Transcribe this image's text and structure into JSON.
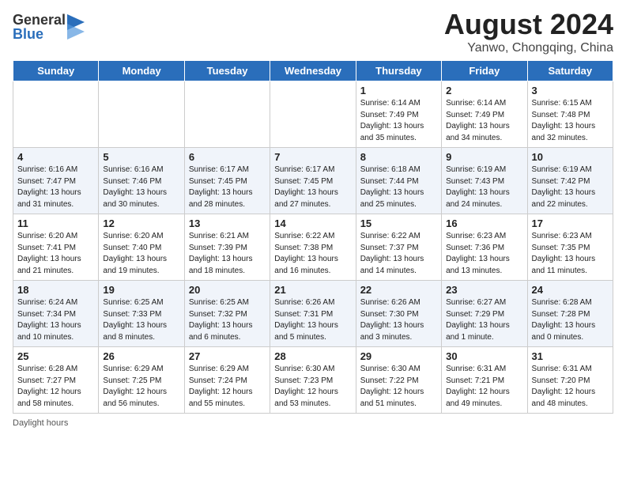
{
  "header": {
    "logo_general": "General",
    "logo_blue": "Blue",
    "title": "August 2024",
    "subtitle": "Yanwo, Chongqing, China"
  },
  "days_of_week": [
    "Sunday",
    "Monday",
    "Tuesday",
    "Wednesday",
    "Thursday",
    "Friday",
    "Saturday"
  ],
  "weeks": [
    [
      {
        "day": "",
        "info": ""
      },
      {
        "day": "",
        "info": ""
      },
      {
        "day": "",
        "info": ""
      },
      {
        "day": "",
        "info": ""
      },
      {
        "day": "1",
        "info": "Sunrise: 6:14 AM\nSunset: 7:49 PM\nDaylight: 13 hours\nand 35 minutes."
      },
      {
        "day": "2",
        "info": "Sunrise: 6:14 AM\nSunset: 7:49 PM\nDaylight: 13 hours\nand 34 minutes."
      },
      {
        "day": "3",
        "info": "Sunrise: 6:15 AM\nSunset: 7:48 PM\nDaylight: 13 hours\nand 32 minutes."
      }
    ],
    [
      {
        "day": "4",
        "info": "Sunrise: 6:16 AM\nSunset: 7:47 PM\nDaylight: 13 hours\nand 31 minutes."
      },
      {
        "day": "5",
        "info": "Sunrise: 6:16 AM\nSunset: 7:46 PM\nDaylight: 13 hours\nand 30 minutes."
      },
      {
        "day": "6",
        "info": "Sunrise: 6:17 AM\nSunset: 7:45 PM\nDaylight: 13 hours\nand 28 minutes."
      },
      {
        "day": "7",
        "info": "Sunrise: 6:17 AM\nSunset: 7:45 PM\nDaylight: 13 hours\nand 27 minutes."
      },
      {
        "day": "8",
        "info": "Sunrise: 6:18 AM\nSunset: 7:44 PM\nDaylight: 13 hours\nand 25 minutes."
      },
      {
        "day": "9",
        "info": "Sunrise: 6:19 AM\nSunset: 7:43 PM\nDaylight: 13 hours\nand 24 minutes."
      },
      {
        "day": "10",
        "info": "Sunrise: 6:19 AM\nSunset: 7:42 PM\nDaylight: 13 hours\nand 22 minutes."
      }
    ],
    [
      {
        "day": "11",
        "info": "Sunrise: 6:20 AM\nSunset: 7:41 PM\nDaylight: 13 hours\nand 21 minutes."
      },
      {
        "day": "12",
        "info": "Sunrise: 6:20 AM\nSunset: 7:40 PM\nDaylight: 13 hours\nand 19 minutes."
      },
      {
        "day": "13",
        "info": "Sunrise: 6:21 AM\nSunset: 7:39 PM\nDaylight: 13 hours\nand 18 minutes."
      },
      {
        "day": "14",
        "info": "Sunrise: 6:22 AM\nSunset: 7:38 PM\nDaylight: 13 hours\nand 16 minutes."
      },
      {
        "day": "15",
        "info": "Sunrise: 6:22 AM\nSunset: 7:37 PM\nDaylight: 13 hours\nand 14 minutes."
      },
      {
        "day": "16",
        "info": "Sunrise: 6:23 AM\nSunset: 7:36 PM\nDaylight: 13 hours\nand 13 minutes."
      },
      {
        "day": "17",
        "info": "Sunrise: 6:23 AM\nSunset: 7:35 PM\nDaylight: 13 hours\nand 11 minutes."
      }
    ],
    [
      {
        "day": "18",
        "info": "Sunrise: 6:24 AM\nSunset: 7:34 PM\nDaylight: 13 hours\nand 10 minutes."
      },
      {
        "day": "19",
        "info": "Sunrise: 6:25 AM\nSunset: 7:33 PM\nDaylight: 13 hours\nand 8 minutes."
      },
      {
        "day": "20",
        "info": "Sunrise: 6:25 AM\nSunset: 7:32 PM\nDaylight: 13 hours\nand 6 minutes."
      },
      {
        "day": "21",
        "info": "Sunrise: 6:26 AM\nSunset: 7:31 PM\nDaylight: 13 hours\nand 5 minutes."
      },
      {
        "day": "22",
        "info": "Sunrise: 6:26 AM\nSunset: 7:30 PM\nDaylight: 13 hours\nand 3 minutes."
      },
      {
        "day": "23",
        "info": "Sunrise: 6:27 AM\nSunset: 7:29 PM\nDaylight: 13 hours\nand 1 minute."
      },
      {
        "day": "24",
        "info": "Sunrise: 6:28 AM\nSunset: 7:28 PM\nDaylight: 13 hours\nand 0 minutes."
      }
    ],
    [
      {
        "day": "25",
        "info": "Sunrise: 6:28 AM\nSunset: 7:27 PM\nDaylight: 12 hours\nand 58 minutes."
      },
      {
        "day": "26",
        "info": "Sunrise: 6:29 AM\nSunset: 7:25 PM\nDaylight: 12 hours\nand 56 minutes."
      },
      {
        "day": "27",
        "info": "Sunrise: 6:29 AM\nSunset: 7:24 PM\nDaylight: 12 hours\nand 55 minutes."
      },
      {
        "day": "28",
        "info": "Sunrise: 6:30 AM\nSunset: 7:23 PM\nDaylight: 12 hours\nand 53 minutes."
      },
      {
        "day": "29",
        "info": "Sunrise: 6:30 AM\nSunset: 7:22 PM\nDaylight: 12 hours\nand 51 minutes."
      },
      {
        "day": "30",
        "info": "Sunrise: 6:31 AM\nSunset: 7:21 PM\nDaylight: 12 hours\nand 49 minutes."
      },
      {
        "day": "31",
        "info": "Sunrise: 6:31 AM\nSunset: 7:20 PM\nDaylight: 12 hours\nand 48 minutes."
      }
    ]
  ],
  "footer": {
    "daylight_label": "Daylight hours"
  }
}
